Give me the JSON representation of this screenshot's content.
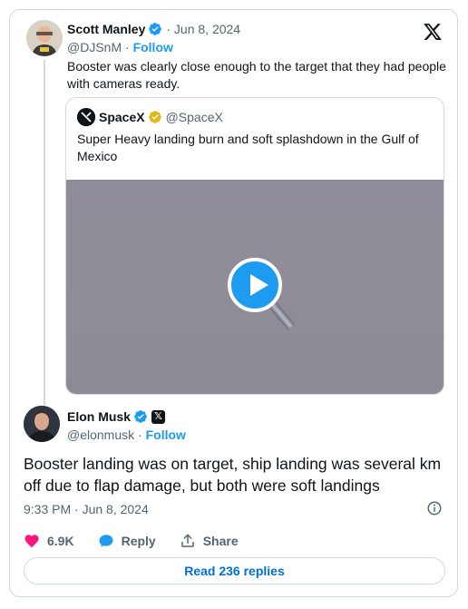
{
  "parent_tweet": {
    "author_name": "Scott Manley",
    "date": "Jun 8, 2024",
    "handle": "@DJSnM",
    "follow_label": "Follow",
    "text": "Booster was clearly close enough to the target that they had people with cameras ready."
  },
  "quoted_tweet": {
    "author_name": "SpaceX",
    "handle": "@SpaceX",
    "text": "Super Heavy landing burn and soft splashdown in the Gulf of Mexico"
  },
  "main_tweet": {
    "author_name": "Elon Musk",
    "handle": "@elonmusk",
    "follow_label": "Follow",
    "text": "Booster landing was on target, ship landing was several km off due to flap damage, but both were soft landings",
    "time": "9:33 PM · Jun 8, 2024"
  },
  "actions": {
    "likes": "6.9K",
    "reply_label": "Reply",
    "share_label": "Share"
  },
  "read_replies_label": "Read 236 replies",
  "colors": {
    "accent": "#1d9bf0",
    "like": "#f91880",
    "gold_badge": "#e2b719"
  }
}
